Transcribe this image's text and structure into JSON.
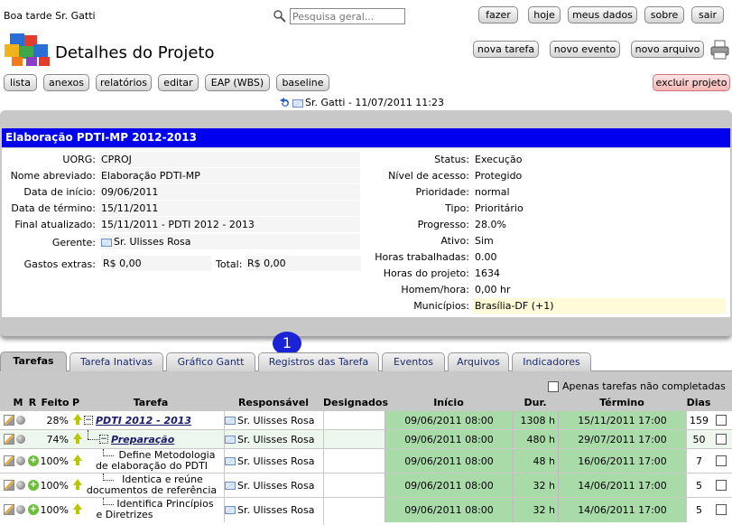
{
  "header": {
    "greeting": "Boa tarde Sr. Gatti",
    "search_placeholder": "Pesquisa geral...",
    "top_buttons": [
      "fazer",
      "hoje",
      "meus dados",
      "sobre",
      "sair"
    ],
    "page_title": "Detalhes do Projeto",
    "action_buttons": [
      "nova tarefa",
      "novo evento",
      "novo arquivo"
    ],
    "toolbar": [
      "lista",
      "anexos",
      "relatórios",
      "editar",
      "EAP (WBS)",
      "baseline"
    ],
    "delete_label": "excluir projeto",
    "last_edit": "Sr. Gatti - 11/07/2011 11:23"
  },
  "project": {
    "title": "Elaboração PDTI-MP 2012-2013",
    "left": [
      {
        "label": "UORG:",
        "value": "CPROJ"
      },
      {
        "label": "Nome abreviado:",
        "value": "Elaboração PDTI-MP"
      },
      {
        "label": "Data de início:",
        "value": "09/06/2011"
      },
      {
        "label": "Data de término:",
        "value": "15/11/2011"
      },
      {
        "label": "Final atualizado:",
        "value": "15/11/2011 - PDTI 2012 - 2013"
      },
      {
        "label": "Gerente:",
        "value": "Sr. Ulisses Rosa"
      }
    ],
    "extra_label": "Gastos extras:",
    "extra_value": "R$ 0,00",
    "total_label": "Total:",
    "total_value": "R$ 0,00",
    "right": [
      {
        "label": "Status:",
        "value": "Execução"
      },
      {
        "label": "Nível de acesso:",
        "value": "Protegido"
      },
      {
        "label": "Prioridade:",
        "value": "normal"
      },
      {
        "label": "Tipo:",
        "value": "Prioritário"
      },
      {
        "label": "Progresso:",
        "value": "28.0%"
      },
      {
        "label": "Ativo:",
        "value": "Sim"
      },
      {
        "label": "Horas trabalhadas:",
        "value": "0.00"
      },
      {
        "label": "Horas do projeto:",
        "value": "1634"
      },
      {
        "label": "Homem/hora:",
        "value": "0,00 hr"
      },
      {
        "label": "Municípios:",
        "value": "Brasília-DF (+1)"
      }
    ]
  },
  "badge": "1",
  "tabs": [
    "Tarefas",
    "Tarefa Inativas",
    "Gráfico Gantt",
    "Registros das Tarefa",
    "Eventos",
    "Arquivos",
    "Indicadores"
  ],
  "filter_label": "Apenas tarefas não completadas",
  "columns": [
    "M",
    "R",
    "Feito",
    "P",
    "Tarefa",
    "Responsável",
    "Designados",
    "Início",
    "Dur.",
    "Término",
    "Dias"
  ],
  "tasks": [
    {
      "done": "28%",
      "task": "PDTI 2012 - 2013",
      "resp": "Sr. Ulisses Rosa",
      "start": "09/06/2011 08:00",
      "dur": "1308 h",
      "end": "15/11/2011 17:00",
      "days": "159"
    },
    {
      "done": "74%",
      "task": "Preparação",
      "resp": "Sr. Ulisses Rosa",
      "start": "09/06/2011 08:00",
      "dur": "480 h",
      "end": "29/07/2011 17:00",
      "days": "50"
    },
    {
      "done": "100%",
      "task1": "Define Metodologia",
      "task2": "de elaboração do PDTI",
      "resp": "Sr. Ulisses Rosa",
      "start": "09/06/2011 08:00",
      "dur": "48 h",
      "end": "16/06/2011 17:00",
      "days": "7"
    },
    {
      "done": "100%",
      "task1": "Identica e reúne",
      "task2": "documentos de referência",
      "resp": "Sr. Ulisses Rosa",
      "start": "09/06/2011 08:00",
      "dur": "32 h",
      "end": "14/06/2011 17:00",
      "days": "5"
    },
    {
      "done": "100%",
      "task1": "Identifica Princípios",
      "task2": "e Diretrizes",
      "resp": "Sr. Ulisses Rosa",
      "start": "09/06/2011 08:00",
      "dur": "32 h",
      "end": "14/06/2011 17:00",
      "days": "5"
    }
  ],
  "colors": {
    "title_bar": "#0000ee",
    "panel": "#c8c8c8",
    "green": "#a9dba9",
    "badge": "#1a23d6"
  }
}
